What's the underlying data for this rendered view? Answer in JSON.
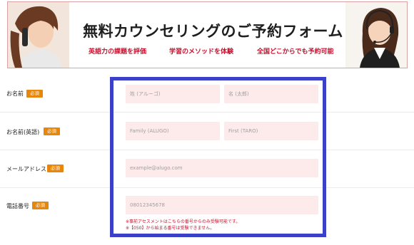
{
  "banner": {
    "title": "無料カウンセリングのご予約フォーム",
    "sub1": "英語力の課題を評価",
    "sub2": "学習のメソッドを体験",
    "sub3": "全国どこからでも予約可能"
  },
  "form": {
    "required_label": "必須",
    "name": {
      "label": "お名前",
      "last_placeholder": "姓 (アルーゴ)",
      "first_placeholder": "名 (太郎)"
    },
    "name_en": {
      "label": "お名前(英語)",
      "last_placeholder": "Family (ALUGO)",
      "first_placeholder": "First (TARO)"
    },
    "email": {
      "label": "メールアドレス",
      "placeholder": "example@alugo.com"
    },
    "phone": {
      "label": "電話番号",
      "placeholder": "08012345678",
      "note1": "※事前アセスメントはこちらの番号からのみ受験可能です。",
      "note2": "※【050】から始まる番号は受験できません。"
    }
  },
  "colors": {
    "accent_blue": "#3b40c8",
    "required_badge": "#e8860b",
    "banner_red": "#c8102e",
    "input_bg": "#fdeaea"
  }
}
